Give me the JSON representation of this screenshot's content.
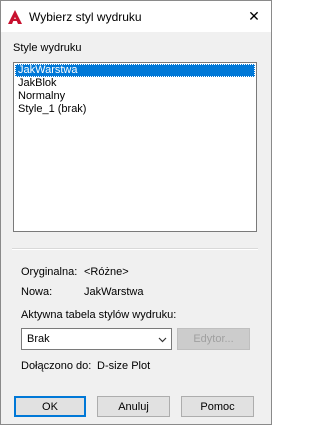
{
  "window": {
    "title": "Wybierz styl wydruku",
    "close_glyph": "✕"
  },
  "styles": {
    "label": "Style wydruku",
    "items": [
      "JakWarstwa",
      "JakBlok",
      "Normalny",
      "Style_1 (brak)"
    ],
    "selected_index": 0
  },
  "info": {
    "original_label": "Oryginalna:",
    "original_value": "<Różne>",
    "new_label": "Nowa:",
    "new_value": "JakWarstwa",
    "table_label": "Aktywna tabela stylów wydruku:",
    "table_value": "Brak",
    "editor_label": "Edytor...",
    "attached_label": "Dołączono do:",
    "attached_value": "D-size Plot"
  },
  "buttons": {
    "ok": "OK",
    "cancel": "Anuluj",
    "help": "Pomoc"
  },
  "colors": {
    "selection": "#0078d7",
    "app_icon": "#c8102e"
  }
}
